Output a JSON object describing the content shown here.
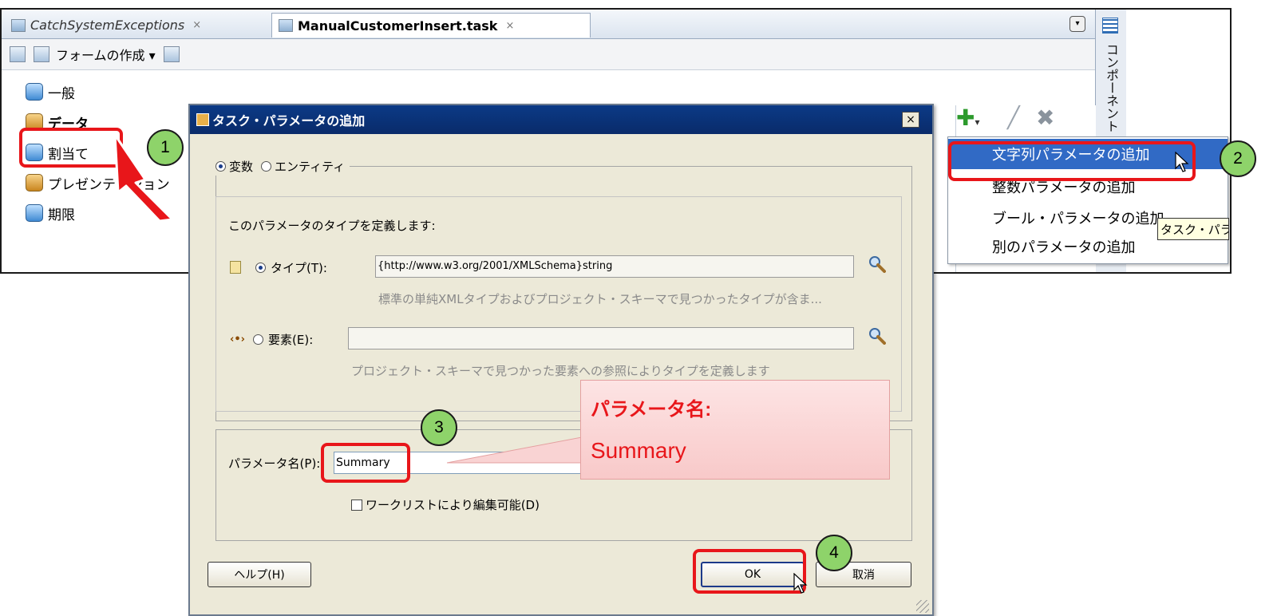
{
  "tabs": [
    {
      "label": "CatchSystemExceptions",
      "close": "×"
    },
    {
      "label": "ManualCustomerInsert.task",
      "close": "×"
    }
  ],
  "toolbar": {
    "create_form_label": "フォームの作成 ▾"
  },
  "right_strip": {
    "label": "コンポーネント"
  },
  "nav": [
    {
      "label": "一般"
    },
    {
      "label": "データ"
    },
    {
      "label": "割当て"
    },
    {
      "label": "プレゼンテーション"
    },
    {
      "label": "期限"
    }
  ],
  "menu": {
    "items": [
      {
        "label": "文字列パラメータの追加"
      },
      {
        "label": "整数パラメータの追加"
      },
      {
        "label": "ブール・パラメータの追加"
      },
      {
        "label": "別のパラメータの追加"
      }
    ],
    "tooltip": "タスク・パラ"
  },
  "dialog": {
    "title": "タスク・パラメータの追加",
    "close": "×",
    "kind_variable": "変数",
    "kind_entity": "エンティティ",
    "define_label": "このパラメータのタイプを定義します:",
    "type_label": "タイプ(T):",
    "type_value": "{http://www.w3.org/2001/XMLSchema}string",
    "type_hint": "標準の単純XMLタイプおよびプロジェクト・スキーマで見つかったタイプが含ま...",
    "element_label": "要素(E):",
    "element_value": "",
    "element_hint": "プロジェクト・スキーマで見つかった要素への参照によりタイプを定義します",
    "param_name_label": "パラメータ名(P):",
    "param_name_value": "Summary",
    "worklist_label": "ワークリストにより編集可能(D)",
    "help_button": "ヘルプ(H)",
    "ok_button": "OK",
    "cancel_button": "取消"
  },
  "annotations": {
    "steps": [
      "1",
      "2",
      "3",
      "4"
    ],
    "callout_title": "パラメータ名:",
    "callout_value": "Summary",
    "accent_color": "#e8161a",
    "circle_color": "#8ed36a"
  }
}
